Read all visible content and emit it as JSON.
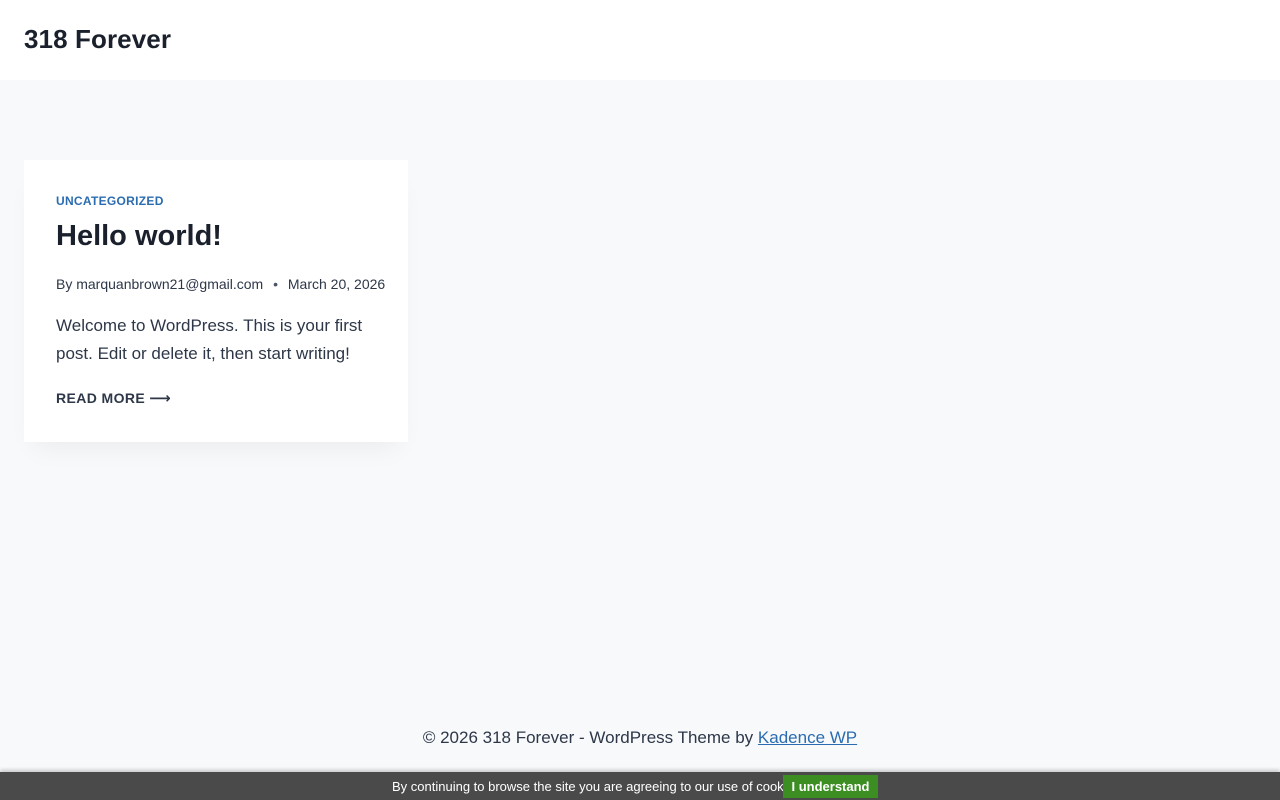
{
  "header": {
    "site_title": "318 Forever"
  },
  "post": {
    "category": "UNCATEGORIZED",
    "title": "Hello world!",
    "author_prefix": "By",
    "author": "marquanbrown21@gmail.com",
    "separator": "•",
    "date": "March 20, 2026",
    "excerpt": "Welcome to WordPress. This is your first post. Edit or delete it, then start writing!",
    "read_more": "READ MORE",
    "read_more_arrow": "⟶"
  },
  "footer": {
    "copyright": "© 2026 318 Forever - WordPress Theme by",
    "theme_link": "Kadence WP"
  },
  "cookie_bar": {
    "message": "By continuing to browse the site you are agreeing to our use of cookies",
    "button_label": "I understand"
  },
  "colors": {
    "accent": "#2b6cb0",
    "background": "#f7f9fb",
    "cookie_bar": "#4a4a4a",
    "cookie_button": "#3c8e23"
  }
}
